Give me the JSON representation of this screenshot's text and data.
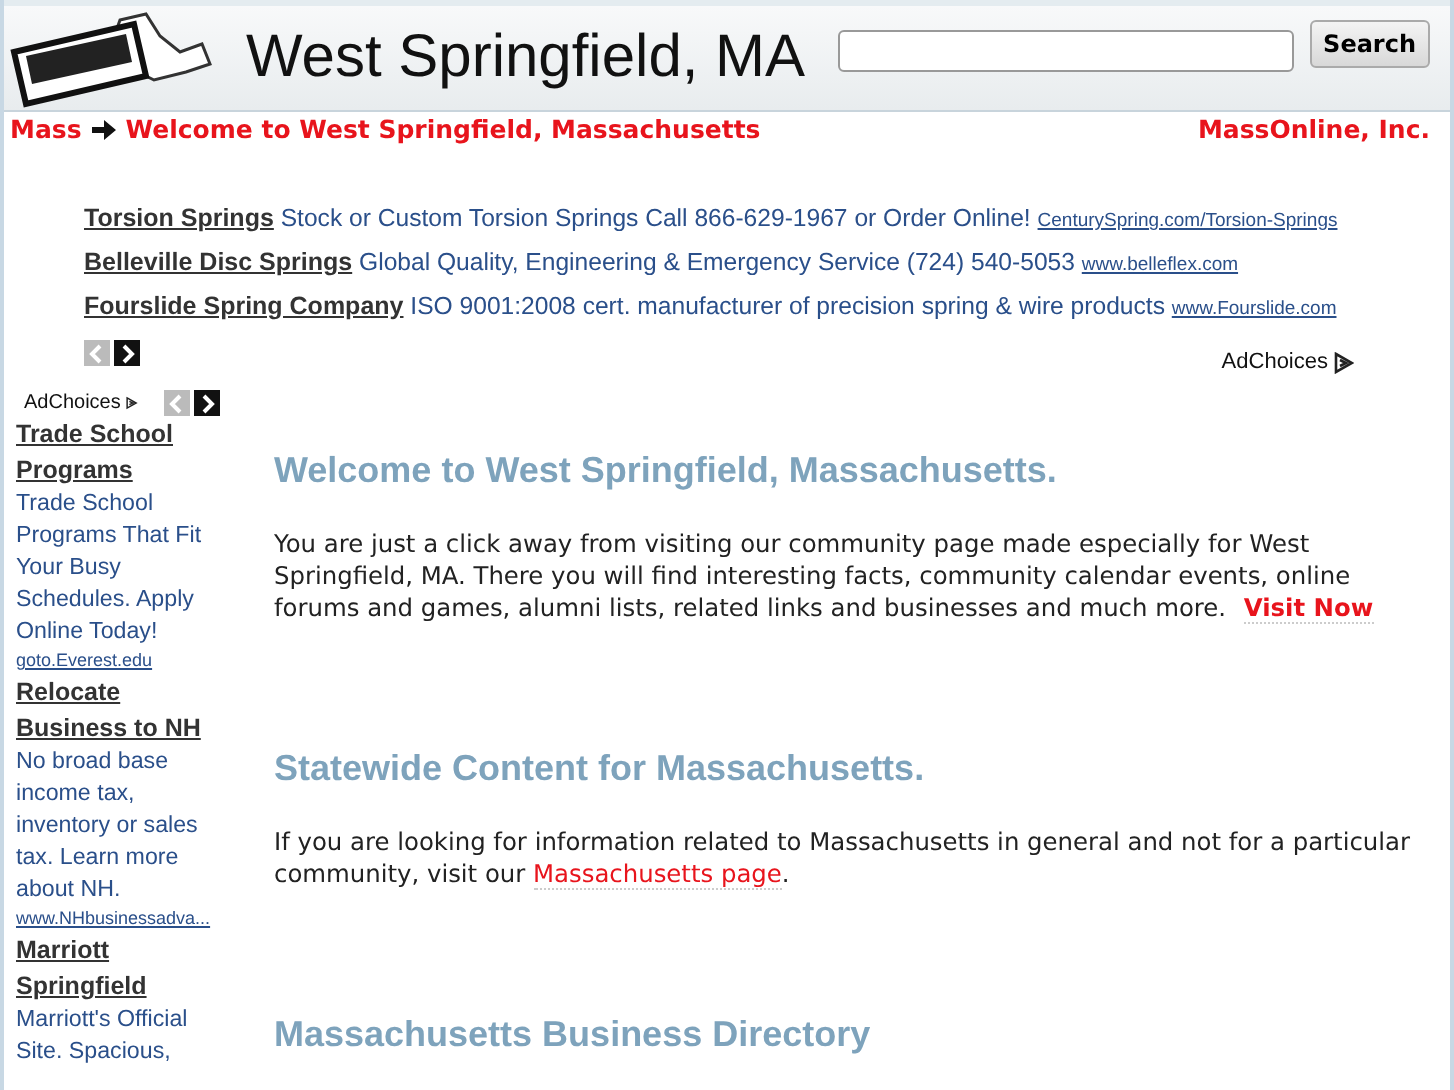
{
  "header": {
    "title": "West Springfield, MA",
    "search_button": "Search"
  },
  "breadcrumb": {
    "items": [
      "Mass",
      "Welcome to West Springfield, Massachusetts"
    ],
    "publisher": "MassOnline, Inc."
  },
  "top_ads": {
    "items": [
      {
        "title": "Torsion Springs",
        "text": "Stock or Custom Torsion Springs Call 866-629-1967 or Order Online!",
        "url": "CenturySpring.com/Torsion-Springs"
      },
      {
        "title": "Belleville Disc Springs",
        "text": "Global Quality, Engineering & Emergency Service (724) 540-5053",
        "url": "www.belleflex.com"
      },
      {
        "title": "Fourslide Spring Company",
        "text": "ISO 9001:2008 cert. manufacturer of precision spring & wire products",
        "url": "www.Fourslide.com"
      }
    ],
    "nav": [
      {
        "kind": "prev",
        "disabled": true
      },
      {
        "kind": "next",
        "disabled": false
      }
    ],
    "adchoices": "AdChoices"
  },
  "side_ads": {
    "adchoices": "AdChoices",
    "nav": [
      {
        "kind": "prev",
        "disabled": true
      },
      {
        "kind": "next",
        "disabled": false
      }
    ],
    "items": [
      {
        "title": "Trade School Programs",
        "text": "Trade School Programs That Fit Your Busy Schedules. Apply Online Today!",
        "url": "goto.Everest.edu"
      },
      {
        "title": "Relocate Business to NH",
        "text": "No broad base income tax, inventory or sales tax. Learn more about NH.",
        "url": "www.NHbusinessadva..."
      },
      {
        "title": "Marriott Springfield",
        "text": "Marriott's Official Site. Spacious,"
      }
    ]
  },
  "sections": [
    {
      "heading": "Welcome to West Springfield, Massachusetts.",
      "text": "You are just a click away from visiting our community page made especially for West Springfield, MA.  There you will find interesting facts, community calendar events, online forums and games, alumni lists, related links and businesses and much more.",
      "link": "Visit Now",
      "link_bold": true
    },
    {
      "heading": "Statewide Content for Massachusetts.",
      "text": "If you are looking for information related to Massachusetts in general and not for a particular community, visit our",
      "link": "Massachusetts page",
      "link_bold": false,
      "after": "."
    },
    {
      "heading": "Massachusetts Business Directory"
    }
  ]
}
